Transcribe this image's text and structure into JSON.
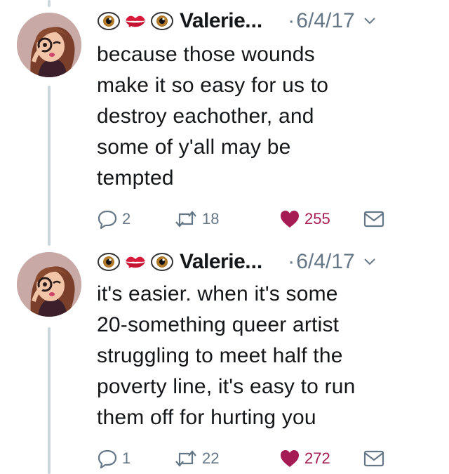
{
  "tweets": [
    {
      "author": "Valerie",
      "ellipsis": "...",
      "dot": "·",
      "date": "6/4/17",
      "text": "because those wounds\nmake it so easy for us to\ndestroy eachother, and\nsome of y'all may be\ntempted",
      "replies": "2",
      "retweets": "18",
      "likes": "255"
    },
    {
      "author": "Valerie",
      "ellipsis": "...",
      "dot": "·",
      "date": "6/4/17",
      "text": "it's easier. when it's some\n20-something queer artist\nstruggling to meet half the\npoverty line, it's easy to run\nthem off for hurting you",
      "replies": "1",
      "retweets": "22",
      "likes": "272"
    }
  ],
  "colors": {
    "text": "#14171a",
    "muted": "#657786",
    "like": "#a51c54",
    "thread": "#ccd6dd"
  },
  "icons": [
    "eye-emoji-icon",
    "kiss-lips-emoji-icon",
    "chevron-down-icon",
    "reply-icon",
    "retweet-icon",
    "heart-icon",
    "message-icon"
  ]
}
